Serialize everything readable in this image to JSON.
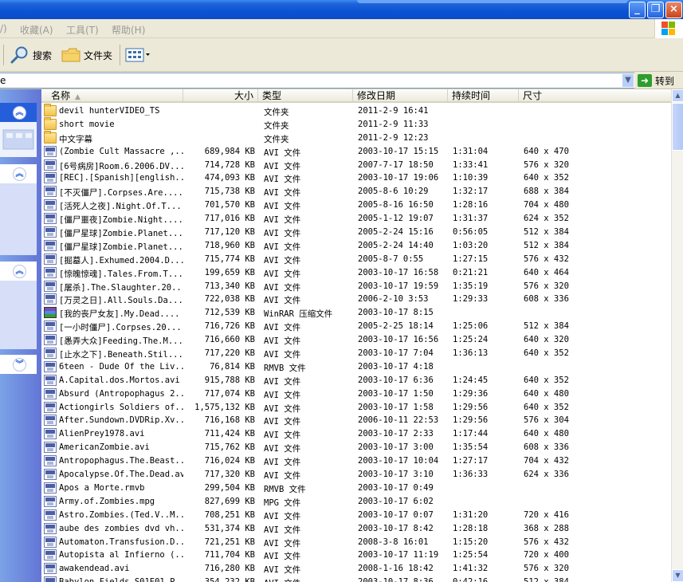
{
  "menu": {
    "partial": "/)",
    "favorites": "收藏(A)",
    "tools": "工具(T)",
    "help": "帮助(H)"
  },
  "toolbar": {
    "search_label": "搜索",
    "folders_label": "文件夹"
  },
  "address": {
    "value": "e",
    "go_label": "转到"
  },
  "columns": {
    "name": "名称",
    "size": "大小",
    "type": "类型",
    "date": "修改日期",
    "duration": "持续时间",
    "dimensions": "尺寸"
  },
  "files": [
    {
      "icon": "folder",
      "name": "devil hunterVIDEO_TS",
      "size": "",
      "type": "文件夹",
      "date": "2011-2-9 16:41",
      "duration": "",
      "dims": ""
    },
    {
      "icon": "folder",
      "name": "short movie",
      "size": "",
      "type": "文件夹",
      "date": "2011-2-9 11:33",
      "duration": "",
      "dims": ""
    },
    {
      "icon": "folder",
      "name": "中文字幕",
      "size": "",
      "type": "文件夹",
      "date": "2011-2-9 12:23",
      "duration": "",
      "dims": ""
    },
    {
      "icon": "media",
      "name": "(Zombie Cult Massacre ,...",
      "size": "689,984 KB",
      "type": "AVI 文件",
      "date": "2003-10-17 15:15",
      "duration": "1:31:04",
      "dims": "640 x 470"
    },
    {
      "icon": "media",
      "name": "[6号病房]Room.6.2006.DV...",
      "size": "714,728 KB",
      "type": "AVI 文件",
      "date": "2007-7-17 18:50",
      "duration": "1:33:41",
      "dims": "576 x 320"
    },
    {
      "icon": "media",
      "name": "[REC].[Spanish][english...",
      "size": "474,093 KB",
      "type": "AVI 文件",
      "date": "2003-10-17 19:06",
      "duration": "1:10:39",
      "dims": "640 x 352"
    },
    {
      "icon": "media",
      "name": "[不灭僵尸].Corpses.Are....",
      "size": "715,738 KB",
      "type": "AVI 文件",
      "date": "2005-8-6 10:29",
      "duration": "1:32:17",
      "dims": "688 x 384"
    },
    {
      "icon": "media",
      "name": "[活死人之夜].Night.Of.T...",
      "size": "701,570 KB",
      "type": "AVI 文件",
      "date": "2005-8-16 16:50",
      "duration": "1:28:16",
      "dims": "704 x 480"
    },
    {
      "icon": "media",
      "name": "[僵尸噩夜]Zombie.Night....",
      "size": "717,016 KB",
      "type": "AVI 文件",
      "date": "2005-1-12 19:07",
      "duration": "1:31:37",
      "dims": "624 x 352"
    },
    {
      "icon": "media",
      "name": "[僵尸星球]Zombie.Planet...",
      "size": "717,120 KB",
      "type": "AVI 文件",
      "date": "2005-2-24 15:16",
      "duration": "0:56:05",
      "dims": "512 x 384"
    },
    {
      "icon": "media",
      "name": "[僵尸星球]Zombie.Planet...",
      "size": "718,960 KB",
      "type": "AVI 文件",
      "date": "2005-2-24 14:40",
      "duration": "1:03:20",
      "dims": "512 x 384"
    },
    {
      "icon": "media",
      "name": "[掘墓人].Exhumed.2004.D...",
      "size": "715,774 KB",
      "type": "AVI 文件",
      "date": "2005-8-7 0:55",
      "duration": "1:27:15",
      "dims": "576 x 432"
    },
    {
      "icon": "media",
      "name": "[惊魄惊魂].Tales.From.T...",
      "size": "199,659 KB",
      "type": "AVI 文件",
      "date": "2003-10-17 16:58",
      "duration": "0:21:21",
      "dims": "640 x 464"
    },
    {
      "icon": "media",
      "name": "[屠杀].The.Slaughter.20...",
      "size": "713,340 KB",
      "type": "AVI 文件",
      "date": "2003-10-17 19:59",
      "duration": "1:35:19",
      "dims": "576 x 320"
    },
    {
      "icon": "media",
      "name": "[万灵之日].All.Souls.Da...",
      "size": "722,038 KB",
      "type": "AVI 文件",
      "date": "2006-2-10 3:53",
      "duration": "1:29:33",
      "dims": "608 x 336"
    },
    {
      "icon": "rar",
      "name": "[我的丧尸女友].My.Dead....",
      "size": "712,539 KB",
      "type": "WinRAR 压缩文件",
      "date": "2003-10-17 8:15",
      "duration": "",
      "dims": ""
    },
    {
      "icon": "media",
      "name": "[一小时僵尸].Corpses.20...",
      "size": "716,726 KB",
      "type": "AVI 文件",
      "date": "2005-2-25 18:14",
      "duration": "1:25:06",
      "dims": "512 x 384"
    },
    {
      "icon": "media",
      "name": "[愚弄大众]Feeding.The.M...",
      "size": "716,660 KB",
      "type": "AVI 文件",
      "date": "2003-10-17 16:56",
      "duration": "1:25:24",
      "dims": "640 x 320"
    },
    {
      "icon": "media",
      "name": "[止水之下].Beneath.Stil...",
      "size": "717,220 KB",
      "type": "AVI 文件",
      "date": "2003-10-17 7:04",
      "duration": "1:36:13",
      "dims": "640 x 352"
    },
    {
      "icon": "media",
      "name": "6teen - Dude Of the Liv...",
      "size": "76,814 KB",
      "type": "RMVB 文件",
      "date": "2003-10-17 4:18",
      "duration": "",
      "dims": ""
    },
    {
      "icon": "media",
      "name": "A.Capital.dos.Mortos.avi",
      "size": "915,788 KB",
      "type": "AVI 文件",
      "date": "2003-10-17 6:36",
      "duration": "1:24:45",
      "dims": "640 x 352"
    },
    {
      "icon": "media",
      "name": "Absurd (Antropophagus 2...",
      "size": "717,074 KB",
      "type": "AVI 文件",
      "date": "2003-10-17 1:50",
      "duration": "1:29:36",
      "dims": "640 x 480"
    },
    {
      "icon": "media",
      "name": "Actiongirls Soldiers of...",
      "size": "1,575,132 KB",
      "type": "AVI 文件",
      "date": "2003-10-17 1:58",
      "duration": "1:29:56",
      "dims": "640 x 352"
    },
    {
      "icon": "media",
      "name": "After.Sundown.DVDRip.Xv...",
      "size": "716,168 KB",
      "type": "AVI 文件",
      "date": "2006-10-11 22:53",
      "duration": "1:29:56",
      "dims": "576 x 304"
    },
    {
      "icon": "media",
      "name": "AlienPrey1978.avi",
      "size": "711,424 KB",
      "type": "AVI 文件",
      "date": "2003-10-17 2:33",
      "duration": "1:17:44",
      "dims": "640 x 480"
    },
    {
      "icon": "media",
      "name": "AmericanZombie.avi",
      "size": "715,762 KB",
      "type": "AVI 文件",
      "date": "2003-10-17 3:00",
      "duration": "1:35:54",
      "dims": "608 x 336"
    },
    {
      "icon": "media",
      "name": "Antropophagus.The.Beast...",
      "size": "716,024 KB",
      "type": "AVI 文件",
      "date": "2003-10-17 10:04",
      "duration": "1:27:17",
      "dims": "704 x 432"
    },
    {
      "icon": "media",
      "name": "Apocalypse.Of.The.Dead.avi",
      "size": "717,320 KB",
      "type": "AVI 文件",
      "date": "2003-10-17 3:10",
      "duration": "1:36:33",
      "dims": "624 x 336"
    },
    {
      "icon": "media",
      "name": "Apos a Morte.rmvb",
      "size": "299,504 KB",
      "type": "RMVB 文件",
      "date": "2003-10-17 0:49",
      "duration": "",
      "dims": ""
    },
    {
      "icon": "media",
      "name": "Army.of.Zombies.mpg",
      "size": "827,699 KB",
      "type": "MPG 文件",
      "date": "2003-10-17 6:02",
      "duration": "",
      "dims": ""
    },
    {
      "icon": "media",
      "name": "Astro.Zombies.(Ted.V..M...",
      "size": "708,251 KB",
      "type": "AVI 文件",
      "date": "2003-10-17 0:07",
      "duration": "1:31:20",
      "dims": "720 x 416"
    },
    {
      "icon": "media",
      "name": "aube des zombies dvd vh...",
      "size": "531,374 KB",
      "type": "AVI 文件",
      "date": "2003-10-17 8:42",
      "duration": "1:28:18",
      "dims": "368 x 288"
    },
    {
      "icon": "media",
      "name": "Automaton.Transfusion.D...",
      "size": "721,251 KB",
      "type": "AVI 文件",
      "date": "2008-3-8 16:01",
      "duration": "1:15:20",
      "dims": "576 x 432"
    },
    {
      "icon": "media",
      "name": "Autopista al Infierno (...",
      "size": "711,704 KB",
      "type": "AVI 文件",
      "date": "2003-10-17 11:19",
      "duration": "1:25:54",
      "dims": "720 x 400"
    },
    {
      "icon": "media",
      "name": "awakendead.avi",
      "size": "716,280 KB",
      "type": "AVI 文件",
      "date": "2008-1-16 18:42",
      "duration": "1:41:32",
      "dims": "576 x 320"
    },
    {
      "icon": "media",
      "name": "Babylon.Fields.S01E01.P...",
      "size": "354,232 KB",
      "type": "AVI 文件",
      "date": "2003-10-17 8:36",
      "duration": "0:42:16",
      "dims": "512 x 384"
    }
  ]
}
